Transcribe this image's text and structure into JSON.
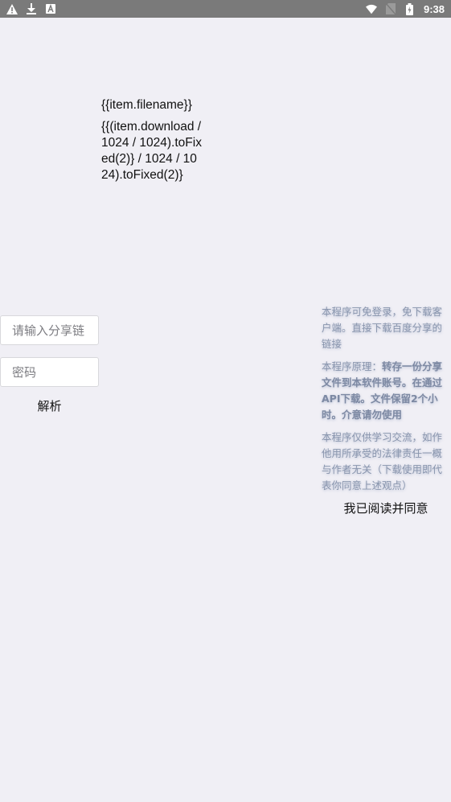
{
  "status_bar": {
    "left_icons": [
      "warning-icon",
      "download-icon",
      "app-a-icon"
    ],
    "right_icons": [
      "wifi-icon",
      "no-sim-icon",
      "battery-icon"
    ],
    "time": "9:38"
  },
  "file": {
    "name": "{{item.filename}}",
    "size": "{{(item.download / 1024 / 1024).toFixed(2)} / 1024 / 1024).toFixed(2)}"
  },
  "form": {
    "link_placeholder": "请输入分享链",
    "password_placeholder": "密码",
    "parse_label": "解析"
  },
  "notice": {
    "p1": "本程序可免登录，免下载客户端。直接下载百度分享的链接",
    "p2_prefix": "本程序原理：",
    "p2_strong": "转存一份分享文件到本软件账号。在通过API下载。文件保留2个小时。介意请勿使用",
    "p3": "本程序仅供学习交流，如作他用所承受的法律责任一概与作者无关（下载使用即代表你同意上述观点）",
    "agree_label": "我已阅读并同意"
  },
  "colors": {
    "background": "#f0eff5",
    "status_bar": "#7a7a7a",
    "notice_text": "#8a96ae"
  }
}
